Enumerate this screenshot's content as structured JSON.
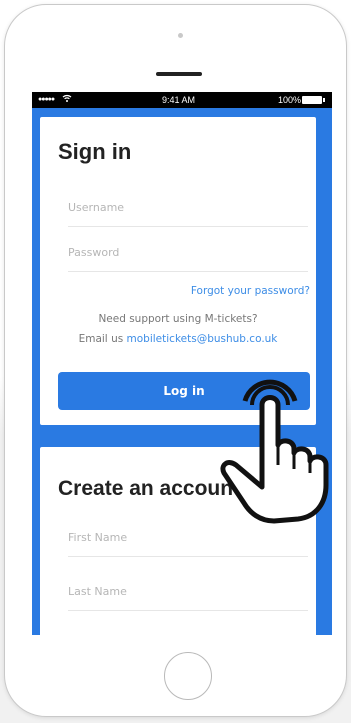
{
  "status_bar": {
    "signal": "●●●●●",
    "time": "9:41 AM",
    "battery_percent": "100%"
  },
  "signin": {
    "title": "Sign in",
    "username_placeholder": "Username",
    "password_placeholder": "Password",
    "forgot_link": "Forgot your password?",
    "support_text": "Need support using M-tickets?",
    "email_prefix": "Email us ",
    "email_address": "mobiletickets@bushub.co.uk",
    "login_button": "Log in"
  },
  "create_account": {
    "title": "Create an account",
    "first_name_placeholder": "First Name",
    "last_name_placeholder": "Last Name"
  },
  "colors": {
    "accent": "#2a7ae2",
    "link": "#3d8de6"
  },
  "icons": [
    "wifi-icon",
    "battery-icon",
    "tap-hand-icon"
  ]
}
